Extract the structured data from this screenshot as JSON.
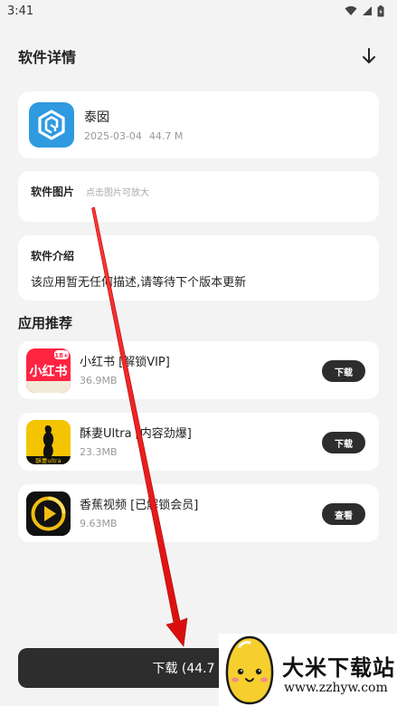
{
  "status_bar": {
    "time": "3:41"
  },
  "header": {
    "title": "软件详情"
  },
  "app": {
    "name": "泰囡",
    "date": "2025-03-04",
    "size": "44.7 M"
  },
  "images_section": {
    "label": "软件图片",
    "hint": "点击图片可放大"
  },
  "intro_section": {
    "label": "软件介绍",
    "text": "该应用暂无任何描述,请等待下个版本更新"
  },
  "recommend": {
    "title": "应用推荐",
    "items": [
      {
        "name": "小红书 [解锁VIP]",
        "size": "36.9MB",
        "button": "下载",
        "badge": "18+"
      },
      {
        "name": "酥妻Ultra [内容劲爆]",
        "size": "23.3MB",
        "button": "下载",
        "icon_caption": "酥妻ultra"
      },
      {
        "name": "香蕉视频 [已解锁会员]",
        "size": "9.63MB",
        "button": "查看"
      }
    ]
  },
  "bottom": {
    "label": "下载 (44.7"
  },
  "watermark": {
    "name": "大米下载站",
    "url": "www.zzhyw.com"
  },
  "colors": {
    "accent": "#2d2d2d",
    "app_icon_bg": "#2f9adf",
    "arrow": "#e01010"
  }
}
